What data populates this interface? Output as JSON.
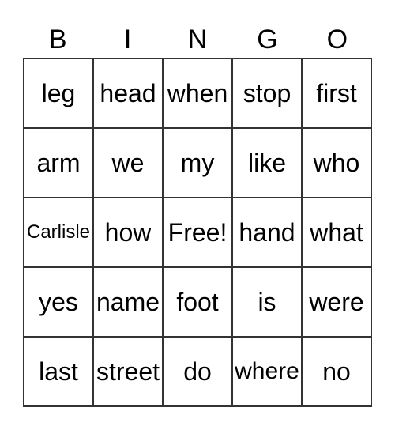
{
  "header": [
    "B",
    "I",
    "N",
    "G",
    "O"
  ],
  "cells": [
    [
      "leg",
      "head",
      "when",
      "stop",
      "first"
    ],
    [
      "arm",
      "we",
      "my",
      "like",
      "who"
    ],
    [
      "Carlisle",
      "how",
      "Free!",
      "hand",
      "what"
    ],
    [
      "yes",
      "name",
      "foot",
      "is",
      "were"
    ],
    [
      "last",
      "street",
      "do",
      "where",
      "no"
    ]
  ]
}
